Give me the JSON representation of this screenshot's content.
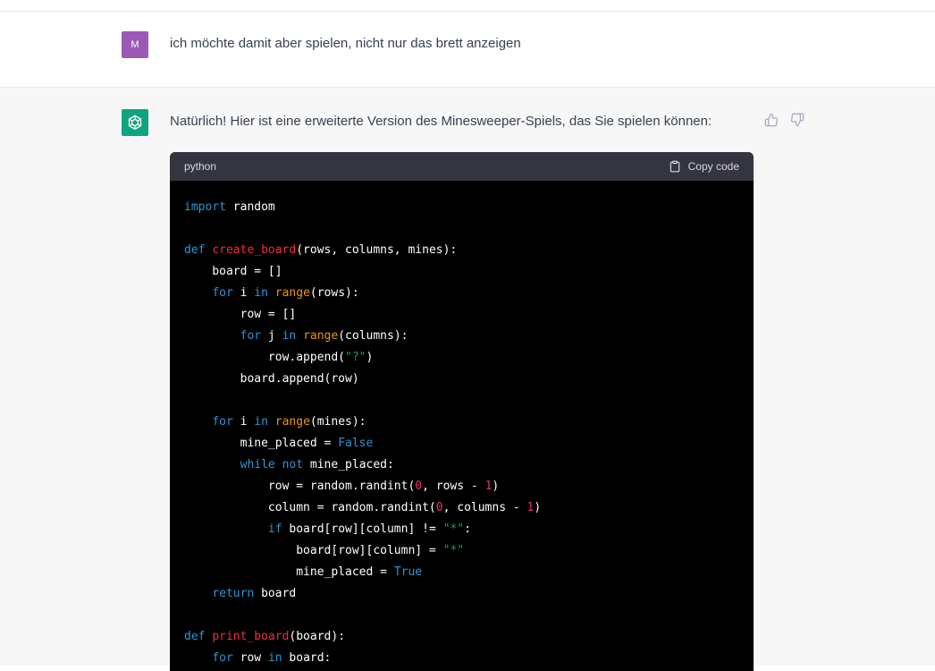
{
  "user_message": {
    "avatar_letter": "M",
    "text": "ich möchte damit aber spielen, nicht nur das brett anzeigen"
  },
  "assistant_message": {
    "text": "Natürlich! Hier ist eine erweiterte Version des Minesweeper-Spiels, das Sie spielen können:",
    "icons": {
      "avatar": "openai-logo-icon",
      "like": "thumbs-up-icon",
      "dislike": "thumbs-down-icon",
      "copy": "clipboard-icon"
    }
  },
  "code_block": {
    "language": "python",
    "copy_label": "Copy code",
    "lines": [
      [
        [
          "kw",
          "import"
        ],
        [
          "t",
          " random"
        ]
      ],
      [],
      [
        [
          "kw",
          "def"
        ],
        [
          "t",
          " "
        ],
        [
          "fn",
          "create_board"
        ],
        [
          "t",
          "(rows, columns, mines):"
        ]
      ],
      [
        [
          "t",
          "    board = []"
        ]
      ],
      [
        [
          "t",
          "    "
        ],
        [
          "kw",
          "for"
        ],
        [
          "t",
          " i "
        ],
        [
          "kw",
          "in"
        ],
        [
          "t",
          " "
        ],
        [
          "bi",
          "range"
        ],
        [
          "t",
          "(rows):"
        ]
      ],
      [
        [
          "t",
          "        row = []"
        ]
      ],
      [
        [
          "t",
          "        "
        ],
        [
          "kw",
          "for"
        ],
        [
          "t",
          " j "
        ],
        [
          "kw",
          "in"
        ],
        [
          "t",
          " "
        ],
        [
          "bi",
          "range"
        ],
        [
          "t",
          "(columns):"
        ]
      ],
      [
        [
          "t",
          "            row.append("
        ],
        [
          "st",
          "\"?\""
        ],
        [
          "t",
          ")"
        ]
      ],
      [
        [
          "t",
          "        board.append(row)"
        ]
      ],
      [],
      [
        [
          "t",
          "    "
        ],
        [
          "kw",
          "for"
        ],
        [
          "t",
          " i "
        ],
        [
          "kw",
          "in"
        ],
        [
          "t",
          " "
        ],
        [
          "bi",
          "range"
        ],
        [
          "t",
          "(mines):"
        ]
      ],
      [
        [
          "t",
          "        mine_placed = "
        ],
        [
          "kw",
          "False"
        ]
      ],
      [
        [
          "t",
          "        "
        ],
        [
          "kw",
          "while"
        ],
        [
          "t",
          " "
        ],
        [
          "kw",
          "not"
        ],
        [
          "t",
          " mine_placed:"
        ]
      ],
      [
        [
          "t",
          "            row = random.randint("
        ],
        [
          "nu",
          "0"
        ],
        [
          "t",
          ", rows - "
        ],
        [
          "nu",
          "1"
        ],
        [
          "t",
          ")"
        ]
      ],
      [
        [
          "t",
          "            column = random.randint("
        ],
        [
          "nu",
          "0"
        ],
        [
          "t",
          ", columns - "
        ],
        [
          "nu",
          "1"
        ],
        [
          "t",
          ")"
        ]
      ],
      [
        [
          "t",
          "            "
        ],
        [
          "kw",
          "if"
        ],
        [
          "t",
          " board[row][column] != "
        ],
        [
          "st",
          "\"*\""
        ],
        [
          "t",
          ":"
        ]
      ],
      [
        [
          "t",
          "                board[row][column] = "
        ],
        [
          "st",
          "\"*\""
        ]
      ],
      [
        [
          "t",
          "                mine_placed = "
        ],
        [
          "kw",
          "True"
        ]
      ],
      [
        [
          "t",
          "    "
        ],
        [
          "kw",
          "return"
        ],
        [
          "t",
          " board"
        ]
      ],
      [],
      [
        [
          "kw",
          "def"
        ],
        [
          "t",
          " "
        ],
        [
          "fn",
          "print_board"
        ],
        [
          "t",
          "(board):"
        ]
      ],
      [
        [
          "t",
          "    "
        ],
        [
          "kw",
          "for"
        ],
        [
          "t",
          " row "
        ],
        [
          "kw",
          "in"
        ],
        [
          "t",
          " board:"
        ]
      ]
    ]
  },
  "colors": {
    "user_avatar": "#9b59b6",
    "assistant_avatar": "#10a37f",
    "keyword": "#2e95d3",
    "function": "#f22c3d",
    "builtin": "#e9950c",
    "string": "#00a67d",
    "number": "#df3079"
  }
}
